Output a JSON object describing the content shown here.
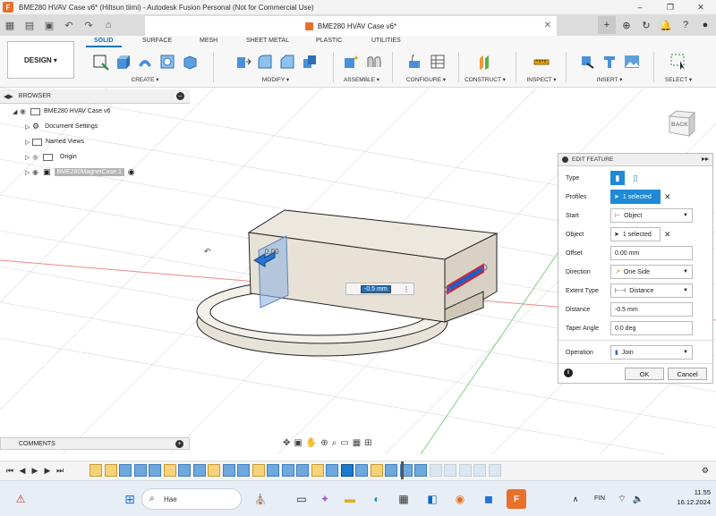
{
  "window": {
    "title": "BME280 HVAV Case v6* (Hiltsun tiimi) - Autodesk Fusion Personal (Not for Commercial Use)",
    "app_logo": "F",
    "controls": [
      "–",
      "❐",
      "✕"
    ]
  },
  "doc_tab": {
    "title": "BME280 HVAV Case v6*",
    "close": "✕"
  },
  "design_button": "DESIGN ▾",
  "ribbon_tabs": [
    "SOLID",
    "SURFACE",
    "MESH",
    "SHEET METAL",
    "PLASTIC",
    "UTILITIES"
  ],
  "ribbon_groups": [
    "CREATE ▾",
    "MODIFY ▾",
    "ASSEMBLE ▾",
    "CONFIGURE ▾",
    "CONSTRUCT ▾",
    "INSPECT ▾",
    "INSERT ▾",
    "SELECT ▾"
  ],
  "browser": {
    "title": "BROWSER",
    "items": [
      {
        "label": "BME280 HVAV Case v6"
      },
      {
        "label": "Document Settings"
      },
      {
        "label": "Named Views"
      },
      {
        "label": "Origin"
      },
      {
        "label": "BME280MagnetCase:1"
      }
    ]
  },
  "viewcube": {
    "face": "BACK"
  },
  "viewport": {
    "distance_input": "-0.5 mm",
    "angle_label": "0.00"
  },
  "edit_feature": {
    "title": "EDIT FEATURE",
    "rows": {
      "type": {
        "label": "Type"
      },
      "profiles": {
        "label": "Profiles",
        "value": "1 selected"
      },
      "start": {
        "label": "Start",
        "value": "Object"
      },
      "object": {
        "label": "Object",
        "value": "1 selected"
      },
      "offset": {
        "label": "Offset",
        "value": "0.00 mm"
      },
      "direction": {
        "label": "Direction",
        "value": "One Side"
      },
      "extent_type": {
        "label": "Extent Type",
        "value": "Distance"
      },
      "distance": {
        "label": "Distance",
        "value": "-0.5 mm"
      },
      "taper_angle": {
        "label": "Taper Angle",
        "value": "0.0 deg"
      },
      "operation": {
        "label": "Operation",
        "value": "Join"
      }
    },
    "ok": "OK",
    "cancel": "Cancel",
    "info": "i"
  },
  "comments": {
    "label": "COMMENTS"
  },
  "taskbar": {
    "search_placeholder": "Hae",
    "language": "FIN",
    "time": "11.55",
    "date": "16.12.2024"
  }
}
